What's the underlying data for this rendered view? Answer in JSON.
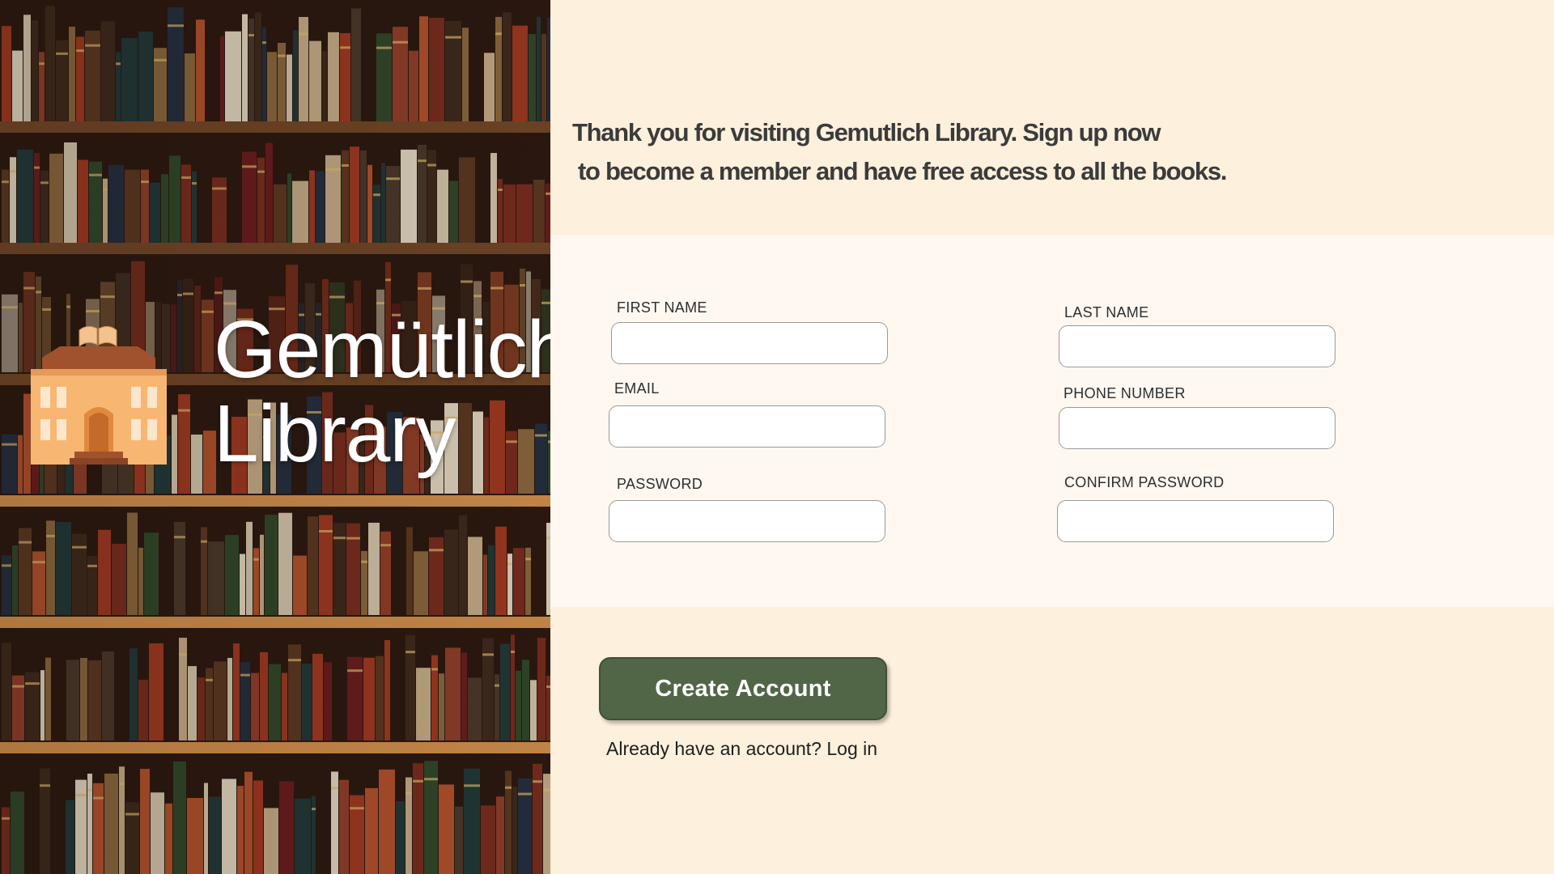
{
  "brand": {
    "line1": "Gemütlich",
    "line2": "Library",
    "logo_icon": "library-building-icon"
  },
  "intro": {
    "line1": "Thank you for visiting Gemutlich Library. Sign up now",
    "line2": "to become a member and have free access to all the books."
  },
  "form": {
    "first_name_label": "FIRST NAME",
    "last_name_label": "LAST NAME",
    "email_label": "EMAIL",
    "phone_label": "PHONE NUMBER",
    "password_label": "PASSWORD",
    "confirm_password_label": "CONFIRM PASSWORD",
    "first_name_value": "",
    "last_name_value": "",
    "email_value": "",
    "phone_value": "",
    "password_value": "",
    "confirm_password_value": ""
  },
  "actions": {
    "create_account_label": "Create Account",
    "login_prompt": "Already have an account?",
    "login_link": "Log in"
  },
  "colors": {
    "button_green": "#516647",
    "panel_cream": "#fdf0dc",
    "form_bg": "#fef8f1",
    "logo_orange": "#f8b673",
    "logo_brown": "#a0522d"
  }
}
